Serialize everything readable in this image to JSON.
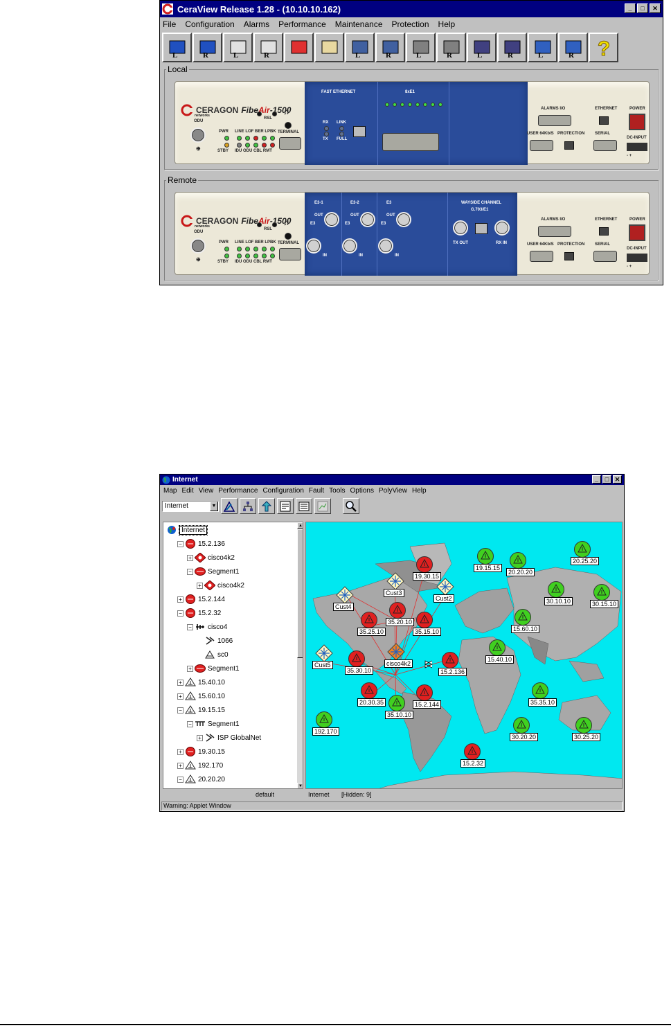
{
  "ceraview": {
    "title": "CeraView Release 1.28  - (10.10.10.162)",
    "menu": [
      "File",
      "Configuration",
      "Alarms",
      "Performance",
      "Maintenance",
      "Protection",
      "Help"
    ],
    "toolbar_icons": [
      "info-local-icon",
      "info-remote-icon",
      "message-local-icon",
      "message-remote-icon",
      "alarm-bell-icon",
      "alarm-log-icon",
      "idu-local-icon",
      "idu-remote-icon",
      "odu-local-icon",
      "odu-remote-icon",
      "tree-local-icon",
      "tree-remote-icon",
      "link-local-icon",
      "link-remote-icon",
      "help-icon"
    ],
    "toolbar_letters": [
      "L",
      "R",
      "L",
      "R",
      "",
      "",
      "L",
      "R",
      "L",
      "R",
      "L",
      "R",
      "L",
      "R",
      ""
    ],
    "local_label": "Local",
    "remote_label": "Remote",
    "device": {
      "brand": "CERAGON",
      "brand_sub": "networks",
      "product_prefix": "Fibe",
      "product_mid": "Air",
      "product_suffix": "-1500",
      "odu": "ODU",
      "rsl": "RSL",
      "pwr": "PWR",
      "stby": "STBY",
      "leds_top": "LINE LOF BER LPBK",
      "leds_bottom": "IDU ODU CBL RMT",
      "terminal": "TERMINAL",
      "alarms_io": "ALARMS I/O",
      "ethernet": "ETHERNET",
      "power": "POWER",
      "user": "USER 64Kb/S",
      "protection": "PROTECTION",
      "serial": "SERIAL",
      "dc_input": "DC-INPUT",
      "dc_polarity": "- +"
    },
    "local_module": {
      "fast_ethernet": "FAST ETHERNET",
      "rx": "RX",
      "tx": "TX",
      "link": "LINK",
      "full": "FULL",
      "e1": "8xE1"
    },
    "remote_module": {
      "e3_1": "E3-1",
      "e3_2": "E3-2",
      "e3_3": "E3",
      "out": "OUT",
      "in": "IN",
      "e3": "E3",
      "wayside": "WAYSIDE CHANNEL",
      "g703": "G.703/E1",
      "tx_out": "TX OUT",
      "rx_in": "RX IN"
    }
  },
  "internet": {
    "title": "Internet",
    "menu": [
      "Map",
      "Edit",
      "View",
      "Performance",
      "Configuration",
      "Fault",
      "Tools",
      "Options",
      "PolyView",
      "Help"
    ],
    "select_value": "Internet",
    "tree": [
      {
        "label": "Internet",
        "level": 0,
        "icon": "globe-icon",
        "exp": ""
      },
      {
        "label": "15.2.136",
        "level": 1,
        "icon": "red-router-icon",
        "exp": "-"
      },
      {
        "label": "cisco4k2",
        "level": 2,
        "icon": "red-diamond-icon",
        "exp": "+"
      },
      {
        "label": "Segment1",
        "level": 2,
        "icon": "red-segment-icon",
        "exp": "-"
      },
      {
        "label": "cisco4k2",
        "level": 3,
        "icon": "red-diamond-icon",
        "exp": "+"
      },
      {
        "label": "15.2.144",
        "level": 1,
        "icon": "red-router-icon",
        "exp": "+"
      },
      {
        "label": "15.2.32",
        "level": 1,
        "icon": "red-router-icon",
        "exp": "-"
      },
      {
        "label": "cisco4",
        "level": 2,
        "icon": "cisco-icon",
        "exp": "-"
      },
      {
        "label": "1066",
        "level": 3,
        "icon": "interface-icon",
        "exp": ""
      },
      {
        "label": "sc0",
        "level": 3,
        "icon": "port-icon",
        "exp": ""
      },
      {
        "label": "Segment1",
        "level": 2,
        "icon": "red-segment-icon",
        "exp": "+"
      },
      {
        "label": "15.40.10",
        "level": 1,
        "icon": "network-icon",
        "exp": "+"
      },
      {
        "label": "15.60.10",
        "level": 1,
        "icon": "network-icon",
        "exp": "+"
      },
      {
        "label": "19.15.15",
        "level": 1,
        "icon": "network-icon",
        "exp": "-"
      },
      {
        "label": "Segment1",
        "level": 2,
        "icon": "bus-icon",
        "exp": "-"
      },
      {
        "label": "ISP GlobalNet",
        "level": 3,
        "icon": "interface-icon",
        "exp": "+"
      },
      {
        "label": "19.30.15",
        "level": 1,
        "icon": "red-router-icon",
        "exp": "+"
      },
      {
        "label": "192.170",
        "level": 1,
        "icon": "network-icon",
        "exp": "+"
      },
      {
        "label": "20.20.20",
        "level": 1,
        "icon": "network-icon",
        "exp": "-"
      }
    ],
    "map_nodes": [
      {
        "label": "19.30.15",
        "kind": "red"
      },
      {
        "label": "Cust3",
        "kind": "yellow"
      },
      {
        "label": "19.15.15",
        "kind": "green"
      },
      {
        "label": "20.20.20",
        "kind": "green"
      },
      {
        "label": "20.25.20",
        "kind": "green"
      },
      {
        "label": "Cust4",
        "kind": "yellow"
      },
      {
        "label": "Cust2",
        "kind": "yellow"
      },
      {
        "label": "30.10.10",
        "kind": "green"
      },
      {
        "label": "30.15.10",
        "kind": "green"
      },
      {
        "label": "35.20.10",
        "kind": "red"
      },
      {
        "label": "35.25.10",
        "kind": "red"
      },
      {
        "label": "35.15.10",
        "kind": "red"
      },
      {
        "label": "15.60.10",
        "kind": "green"
      },
      {
        "label": "Cust5",
        "kind": "yellow"
      },
      {
        "label": "35.30.10",
        "kind": "red"
      },
      {
        "label": "cisco4k2",
        "kind": "orange"
      },
      {
        "label": "15.2.136",
        "kind": "red"
      },
      {
        "label": "15.40.10",
        "kind": "green"
      },
      {
        "label": "20.30.35",
        "kind": "red"
      },
      {
        "label": "15.2.144",
        "kind": "red"
      },
      {
        "label": "35.10.10",
        "kind": "green"
      },
      {
        "label": "35.35.10",
        "kind": "green"
      },
      {
        "label": "192.170",
        "kind": "green"
      },
      {
        "label": "30.20.20",
        "kind": "green"
      },
      {
        "label": "30.25.20",
        "kind": "green"
      },
      {
        "label": "15.2.32",
        "kind": "red"
      }
    ],
    "status": {
      "left": "default",
      "mid": "Internet",
      "right": "[Hidden: 9]"
    },
    "warning": "Warning: Applet Window"
  }
}
